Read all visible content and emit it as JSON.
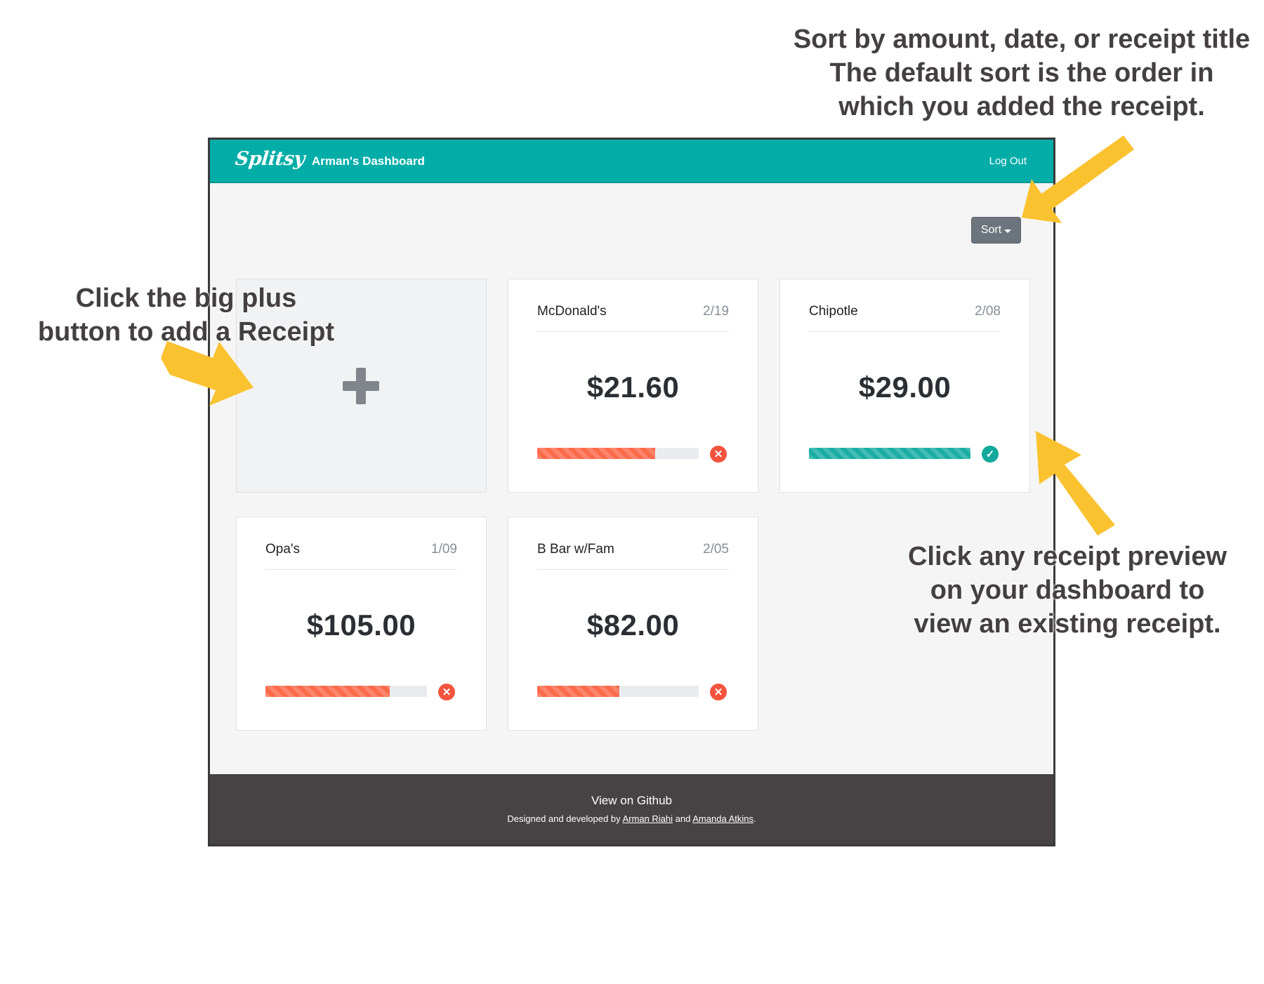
{
  "annotations": {
    "sort": [
      "Sort by amount, date, or receipt title",
      "The default sort is the order in",
      "which you added the receipt."
    ],
    "plus": [
      "Click the big plus",
      "button to add a Receipt"
    ],
    "view": [
      "Click any receipt preview",
      "on your dashboard to",
      "view an existing receipt."
    ],
    "arrow_color": "#fbc230"
  },
  "navbar": {
    "logo": "Splitsy",
    "title": "Arman's Dashboard",
    "logout": "Log Out",
    "color": "#02ada8"
  },
  "toolbar": {
    "sort_label": "Sort"
  },
  "add_card": {
    "icon": "plus-icon"
  },
  "receipts": [
    {
      "title": "McDonald's",
      "date": "2/19",
      "amount": "$21.60",
      "progress": 0.73,
      "status": "unpaid",
      "status_icon": "x-circle-icon",
      "status_symbol": "✕"
    },
    {
      "title": "Chipotle",
      "date": "2/08",
      "amount": "$29.00",
      "progress": 1.0,
      "status": "paid",
      "status_icon": "check-circle-icon",
      "status_symbol": "✓"
    },
    {
      "title": "Opa's",
      "date": "1/09",
      "amount": "$105.00",
      "progress": 0.77,
      "status": "unpaid",
      "status_icon": "x-circle-icon",
      "status_symbol": "✕"
    },
    {
      "title": "B Bar w/Fam",
      "date": "2/05",
      "amount": "$82.00",
      "progress": 0.51,
      "status": "unpaid",
      "status_icon": "x-circle-icon",
      "status_symbol": "✕"
    }
  ],
  "footer": {
    "github": "View on Github",
    "credits_prefix": "Designed and developed by",
    "author1": "Arman Riahi",
    "and": "and",
    "author2": "Amanda Atkins",
    "suffix": ".",
    "color": "#474344"
  }
}
